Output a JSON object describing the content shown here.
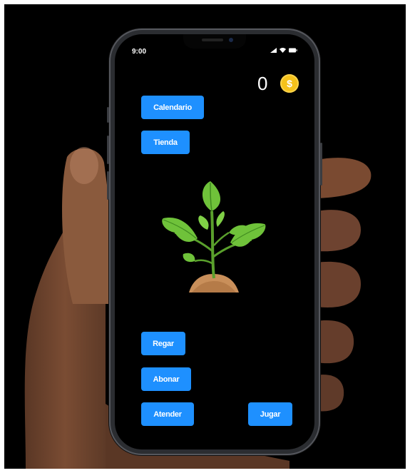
{
  "status_bar": {
    "time": "9:00",
    "icons": [
      "cellular-icon",
      "wifi-icon",
      "battery-icon"
    ]
  },
  "wallet": {
    "coins": "0",
    "coin_symbol": "$",
    "coin_color": "#f5c21b"
  },
  "top_buttons": {
    "calendar_label": "Calendario",
    "shop_label": "Tienda"
  },
  "plant": {
    "icon": "plant-sprout-icon"
  },
  "actions": {
    "water_label": "Regar",
    "fertilize_label": "Abonar",
    "tend_label": "Atender",
    "play_label": "Jugar"
  },
  "colors": {
    "button": "#1e90ff",
    "screen_background": "#000000",
    "leaf": "#6fc23a",
    "soil": "#c98f5a"
  }
}
